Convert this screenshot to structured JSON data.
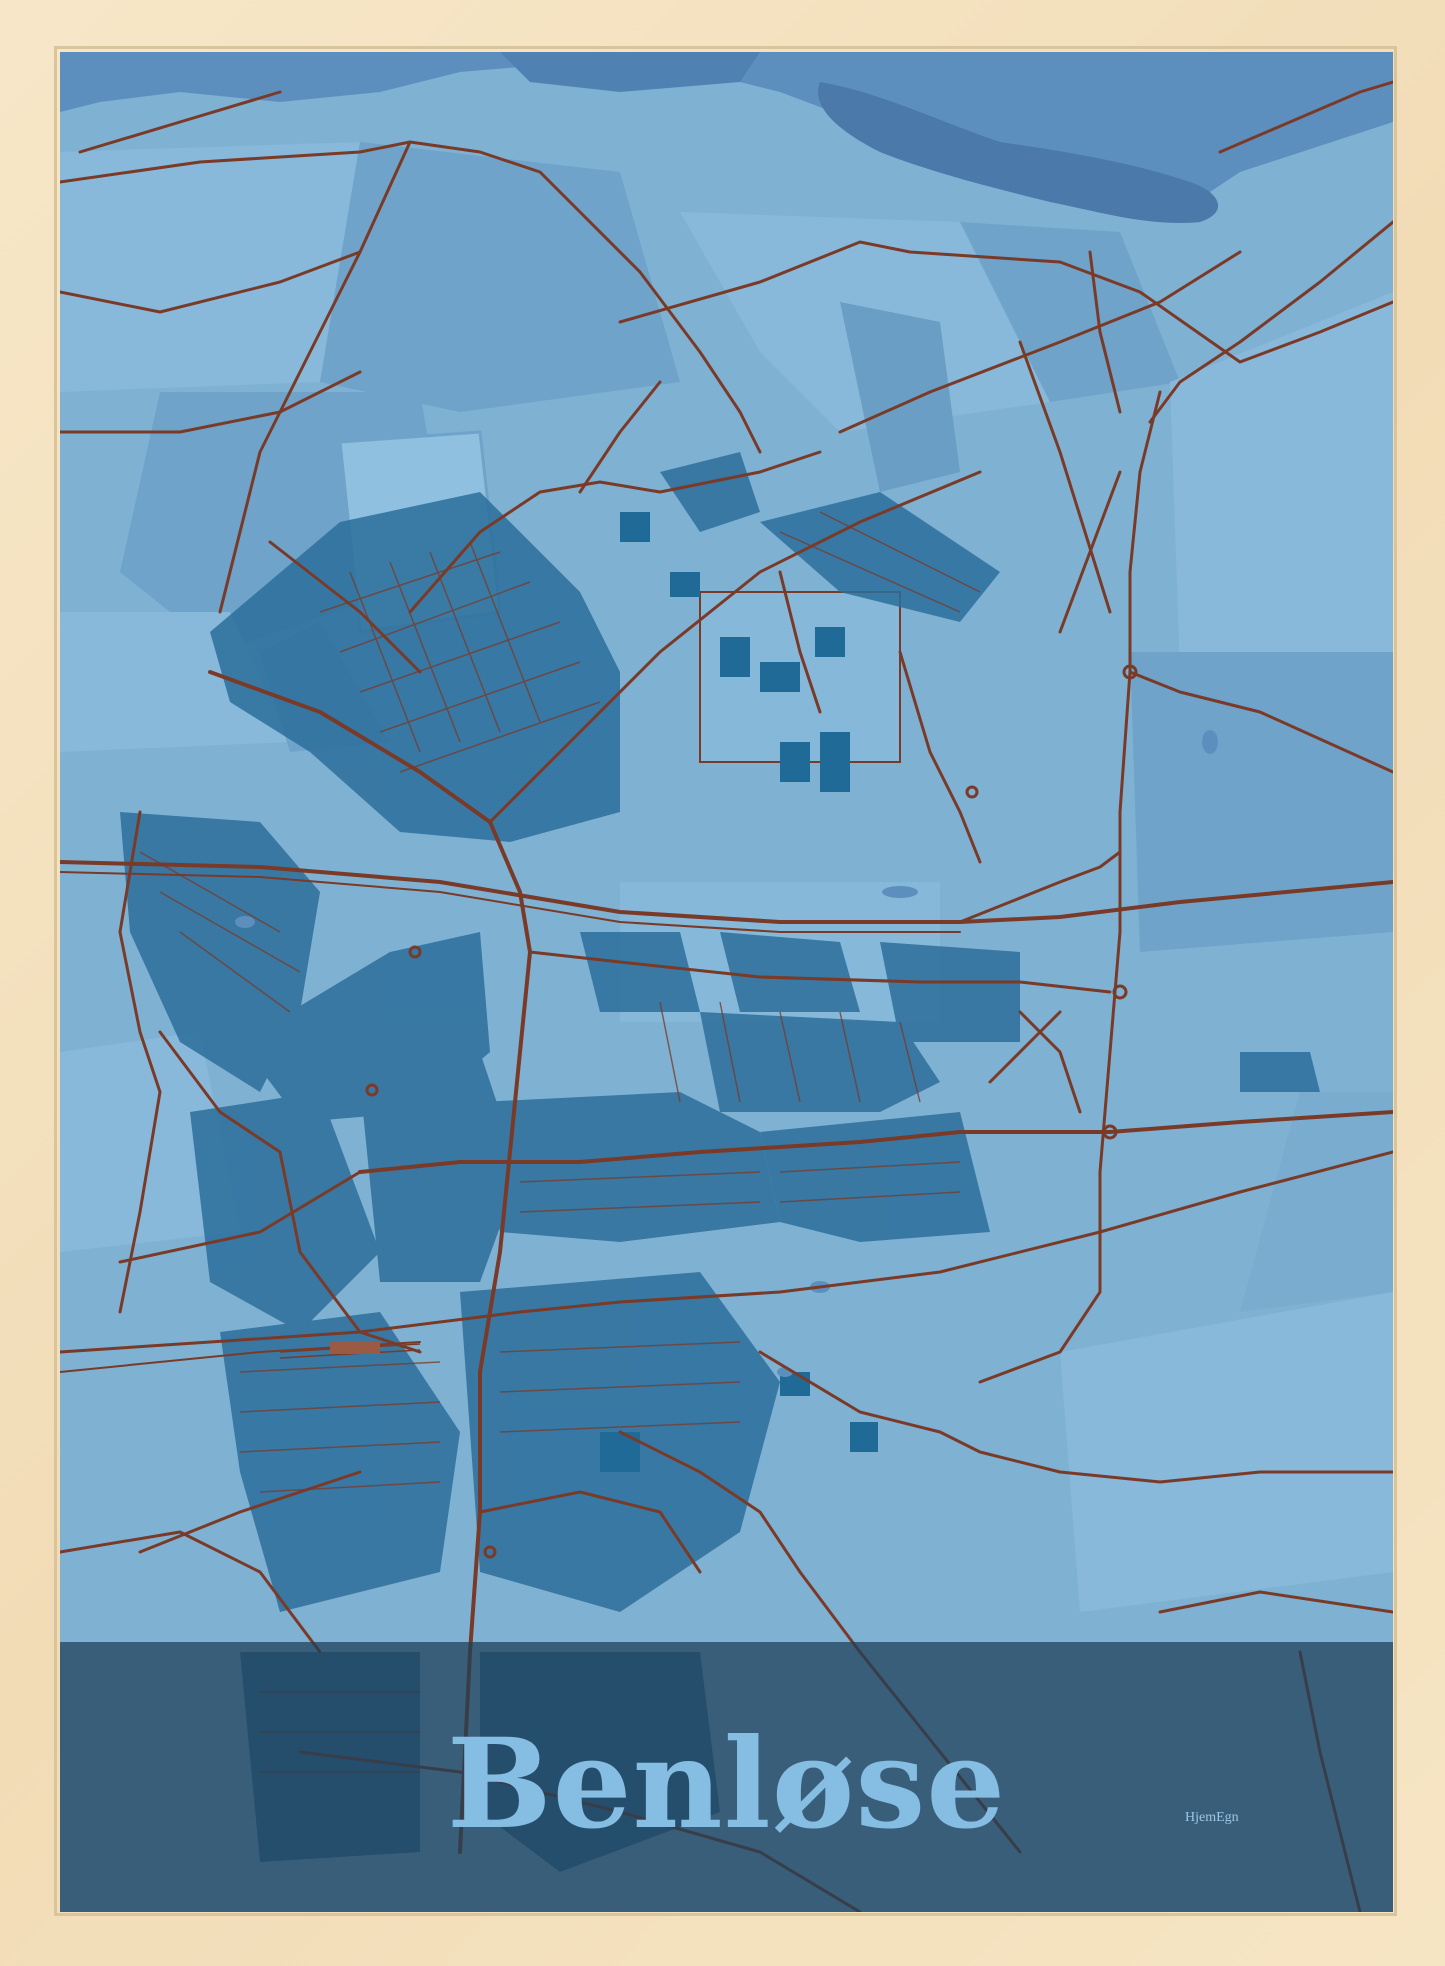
{
  "poster": {
    "title": "Benløse",
    "brand": "HjemEgn"
  },
  "colors": {
    "frame": "#f3e2c0",
    "land": "#7fb1d3",
    "land_dark": "#6fa3c9",
    "water": "#4f82b3",
    "buildings": "#1f6a96",
    "roads": "#7a3a28",
    "title_band": "#1e3e58",
    "title_text": "#86bde2"
  },
  "map_features": [
    "lake",
    "fields",
    "buildings",
    "roads",
    "railway",
    "roundabouts"
  ]
}
